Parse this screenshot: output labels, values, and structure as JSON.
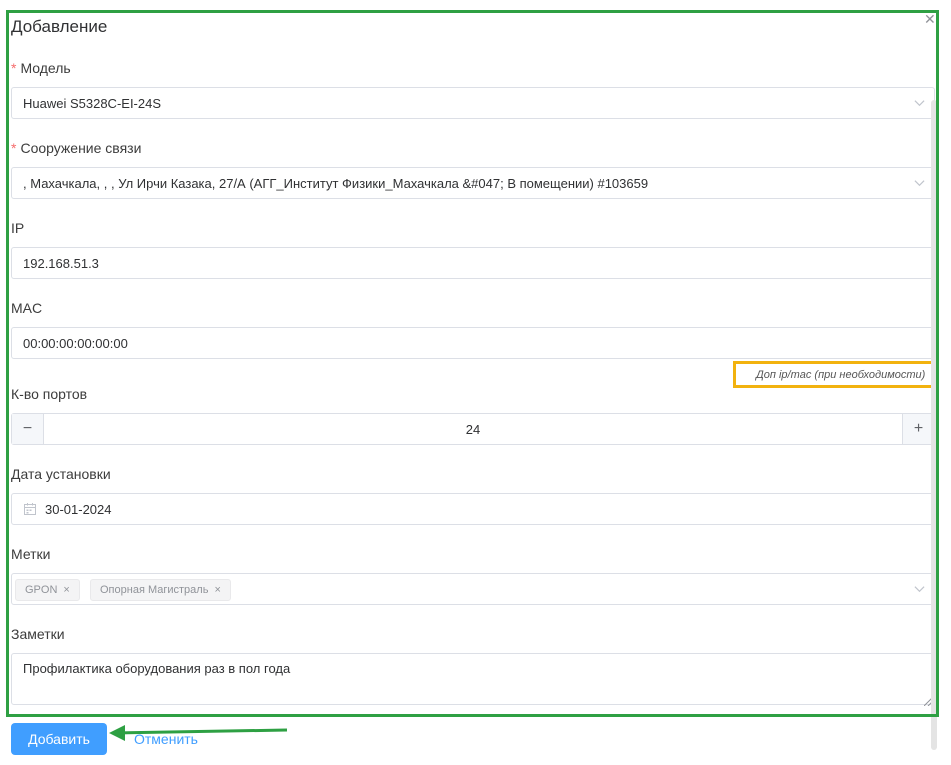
{
  "dialog": {
    "title": "Добавление",
    "close_icon": "close-icon"
  },
  "form": {
    "required_mark": "*",
    "model": {
      "label": "Модель",
      "value": "Huawei S5328C-EI-24S"
    },
    "facility": {
      "label": "Сооружение связи",
      "value": ", Махачкала, , , Ул Ирчи Казака, 27/А (АГГ_Институт Физики_Махачкала &#047; В помещении) #103659"
    },
    "ip": {
      "label": "IP",
      "value": "192.168.51.3"
    },
    "mac": {
      "label": "MAC",
      "value": "00:00:00:00:00:00"
    },
    "extra_link": "Доп ip/mac (при необходимости)",
    "ports": {
      "label": "К-во портов",
      "value": "24",
      "minus": "−",
      "plus": "+"
    },
    "install_date": {
      "label": "Дата установки",
      "value": "30-01-2024"
    },
    "tags": {
      "label": "Метки",
      "items": [
        "GPON",
        "Опорная Магистраль"
      ],
      "remove": "×"
    },
    "notes": {
      "label": "Заметки",
      "value": "Профилактика оборудования раз в пол года"
    }
  },
  "footer": {
    "add_label": "Добавить",
    "cancel_label": "Отменить"
  },
  "colors": {
    "primary": "#409eff",
    "required": "#f56c6c",
    "highlight_green": "#2ea043",
    "highlight_yellow": "#f2b20f"
  }
}
